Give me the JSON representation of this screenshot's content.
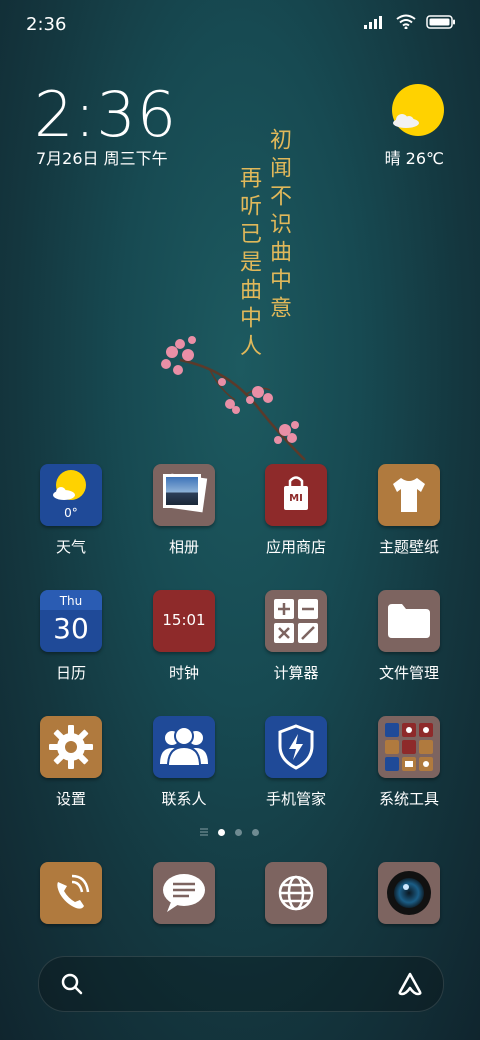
{
  "status_bar": {
    "time": "2:36"
  },
  "clock_widget": {
    "time": "2:36",
    "date": "7月26日 周三下午"
  },
  "weather_widget": {
    "summary": "晴 26℃"
  },
  "wallpaper_poem": {
    "line1": "初闻不识曲中意",
    "line2": "再听已是曲中人"
  },
  "apps": [
    {
      "label": "天气",
      "sub": "0°"
    },
    {
      "label": "相册"
    },
    {
      "label": "应用商店",
      "sub": "MI"
    },
    {
      "label": "主题壁纸"
    },
    {
      "label": "日历",
      "day": "Thu",
      "date": "30"
    },
    {
      "label": "时钟",
      "time": "15:01"
    },
    {
      "label": "计算器"
    },
    {
      "label": "文件管理"
    },
    {
      "label": "设置"
    },
    {
      "label": "联系人"
    },
    {
      "label": "手机管家"
    },
    {
      "label": "系统工具"
    }
  ],
  "dock": [
    "phone-icon",
    "messages-icon",
    "browser-icon",
    "camera-icon"
  ],
  "page_indicator": {
    "pages": 3,
    "current": 1
  },
  "colors": {
    "brown": "#b07a3e",
    "navy": "#1f4a98",
    "maroon": "#8e2a2a",
    "mauve": "#7d6460"
  }
}
